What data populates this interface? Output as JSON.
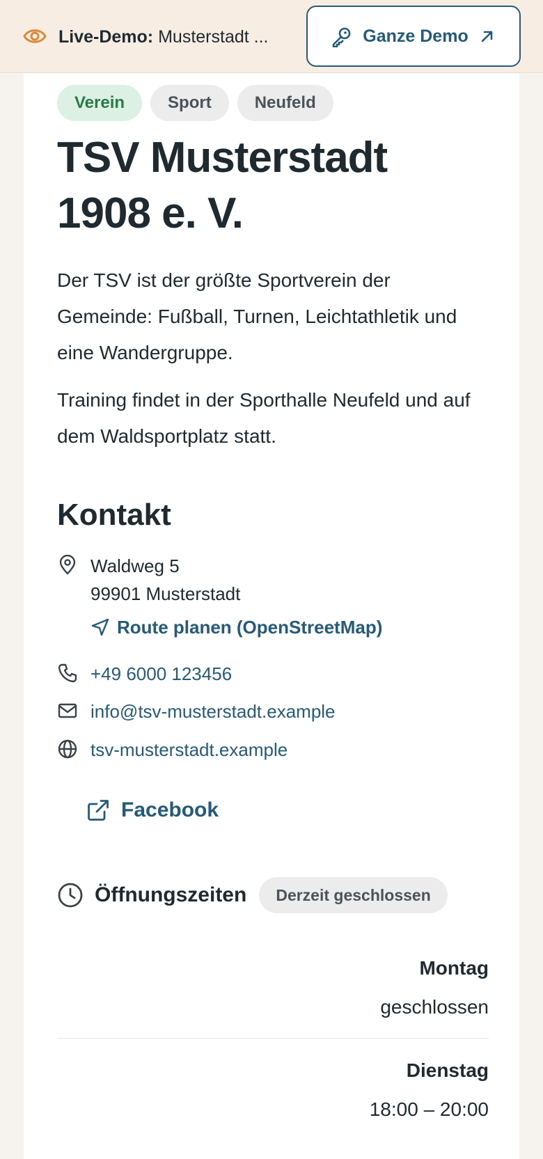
{
  "demo_bar": {
    "label_bold": "Live-Demo:",
    "label_text": "Musterstadt ...",
    "button_label": "Ganze Demo"
  },
  "chips": [
    "Verein",
    "Sport",
    "Neufeld"
  ],
  "title": "TSV Musterstadt 1908 e. V.",
  "description": [
    "Der TSV ist der größte Sportverein der Gemeinde: Fußball, Turnen, Leichtathletik und eine Wandergruppe.",
    "Training findet in der Sporthalle Neufeld und auf dem Waldsportplatz statt."
  ],
  "contact": {
    "heading": "Kontakt",
    "address_line1": "Waldweg 5",
    "address_line2": "99901 Musterstadt",
    "route_label": "Route planen (OpenStreetMap)",
    "phone": "+49 6000 123456",
    "email": "info@tsv-musterstadt.example",
    "website": "tsv-musterstadt.example",
    "facebook": "Facebook"
  },
  "hours": {
    "heading": "Öffnungszeiten",
    "status": "Derzeit geschlossen",
    "days": [
      {
        "name": "Montag",
        "time": "geschlossen"
      },
      {
        "name": "Dienstag",
        "time": "18:00 – 20:00"
      }
    ]
  },
  "colors": {
    "accent": "#255b7a",
    "topbar_bg": "#f8ede3",
    "eye_icon": "#d98a3a",
    "chip_green_bg": "#dcf1e3",
    "chip_green_text": "#2a7a45"
  }
}
